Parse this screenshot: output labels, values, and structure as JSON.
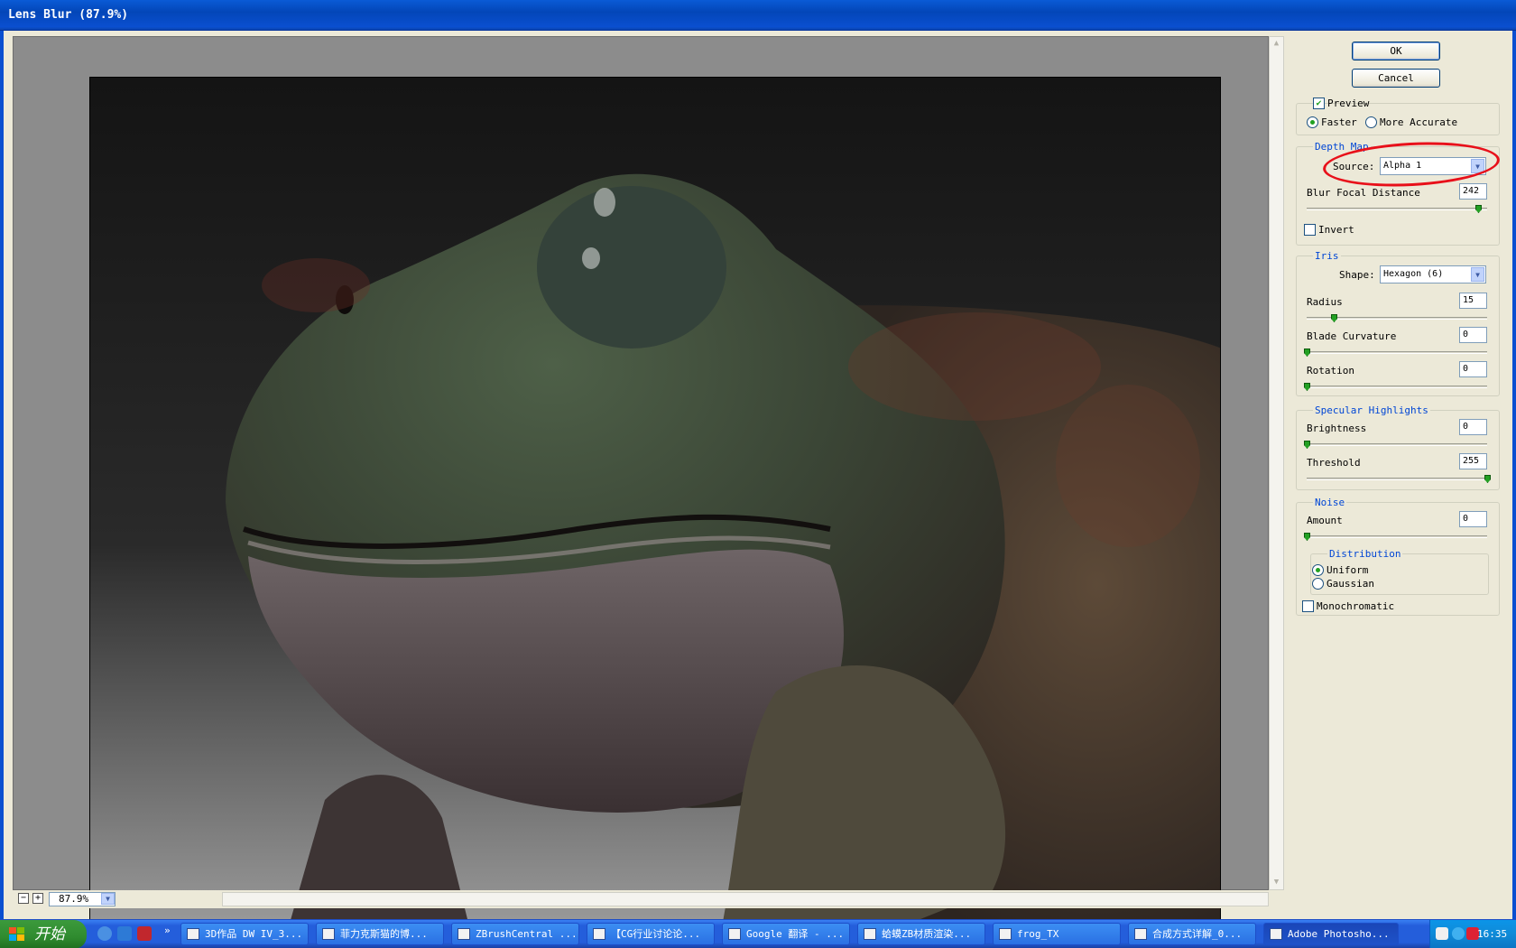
{
  "window": {
    "title": "Lens Blur (87.9%)"
  },
  "buttons": {
    "ok": "OK",
    "cancel": "Cancel"
  },
  "preview": {
    "checkbox_label": "Preview",
    "checked": true,
    "faster": "Faster",
    "more_accurate": "More Accurate",
    "selected": "faster"
  },
  "depth_map": {
    "title": "Depth Map",
    "source_label": "Source:",
    "source_value": "Alpha 1",
    "blur_focal_label": "Blur Focal Distance",
    "blur_focal_value": "242",
    "invert_label": "Invert",
    "invert_checked": false
  },
  "iris": {
    "title": "Iris",
    "shape_label": "Shape:",
    "shape_value": "Hexagon (6)",
    "radius_label": "Radius",
    "radius_value": "15",
    "blade_label": "Blade Curvature",
    "blade_value": "0",
    "rotation_label": "Rotation",
    "rotation_value": "0"
  },
  "specular": {
    "title": "Specular Highlights",
    "brightness_label": "Brightness",
    "brightness_value": "0",
    "threshold_label": "Threshold",
    "threshold_value": "255"
  },
  "noise": {
    "title": "Noise",
    "amount_label": "Amount",
    "amount_value": "0",
    "distribution_title": "Distribution",
    "uniform": "Uniform",
    "gaussian": "Gaussian",
    "distribution_selected": "uniform",
    "monochromatic_label": "Monochromatic",
    "monochromatic_checked": false
  },
  "zoom": {
    "value": "87.9%"
  },
  "taskbar": {
    "start_label": "开始",
    "tasks": [
      "3D作品 DW IV_3...",
      "菲力克斯猫的博...",
      "ZBrushCentral ...",
      "【CG行业讨论论...",
      "Google 翻译 - ...",
      "蛤蟆ZB材质渲染...",
      "frog_TX",
      "合成方式详解_0...",
      "Adobe Photosho..."
    ],
    "clock": "16:35"
  },
  "colors": {
    "title_bar": "#0a4fd0",
    "group_title": "#0046d5",
    "highlight_ring": "#e8101a",
    "slider_thumb": "#23a023"
  }
}
